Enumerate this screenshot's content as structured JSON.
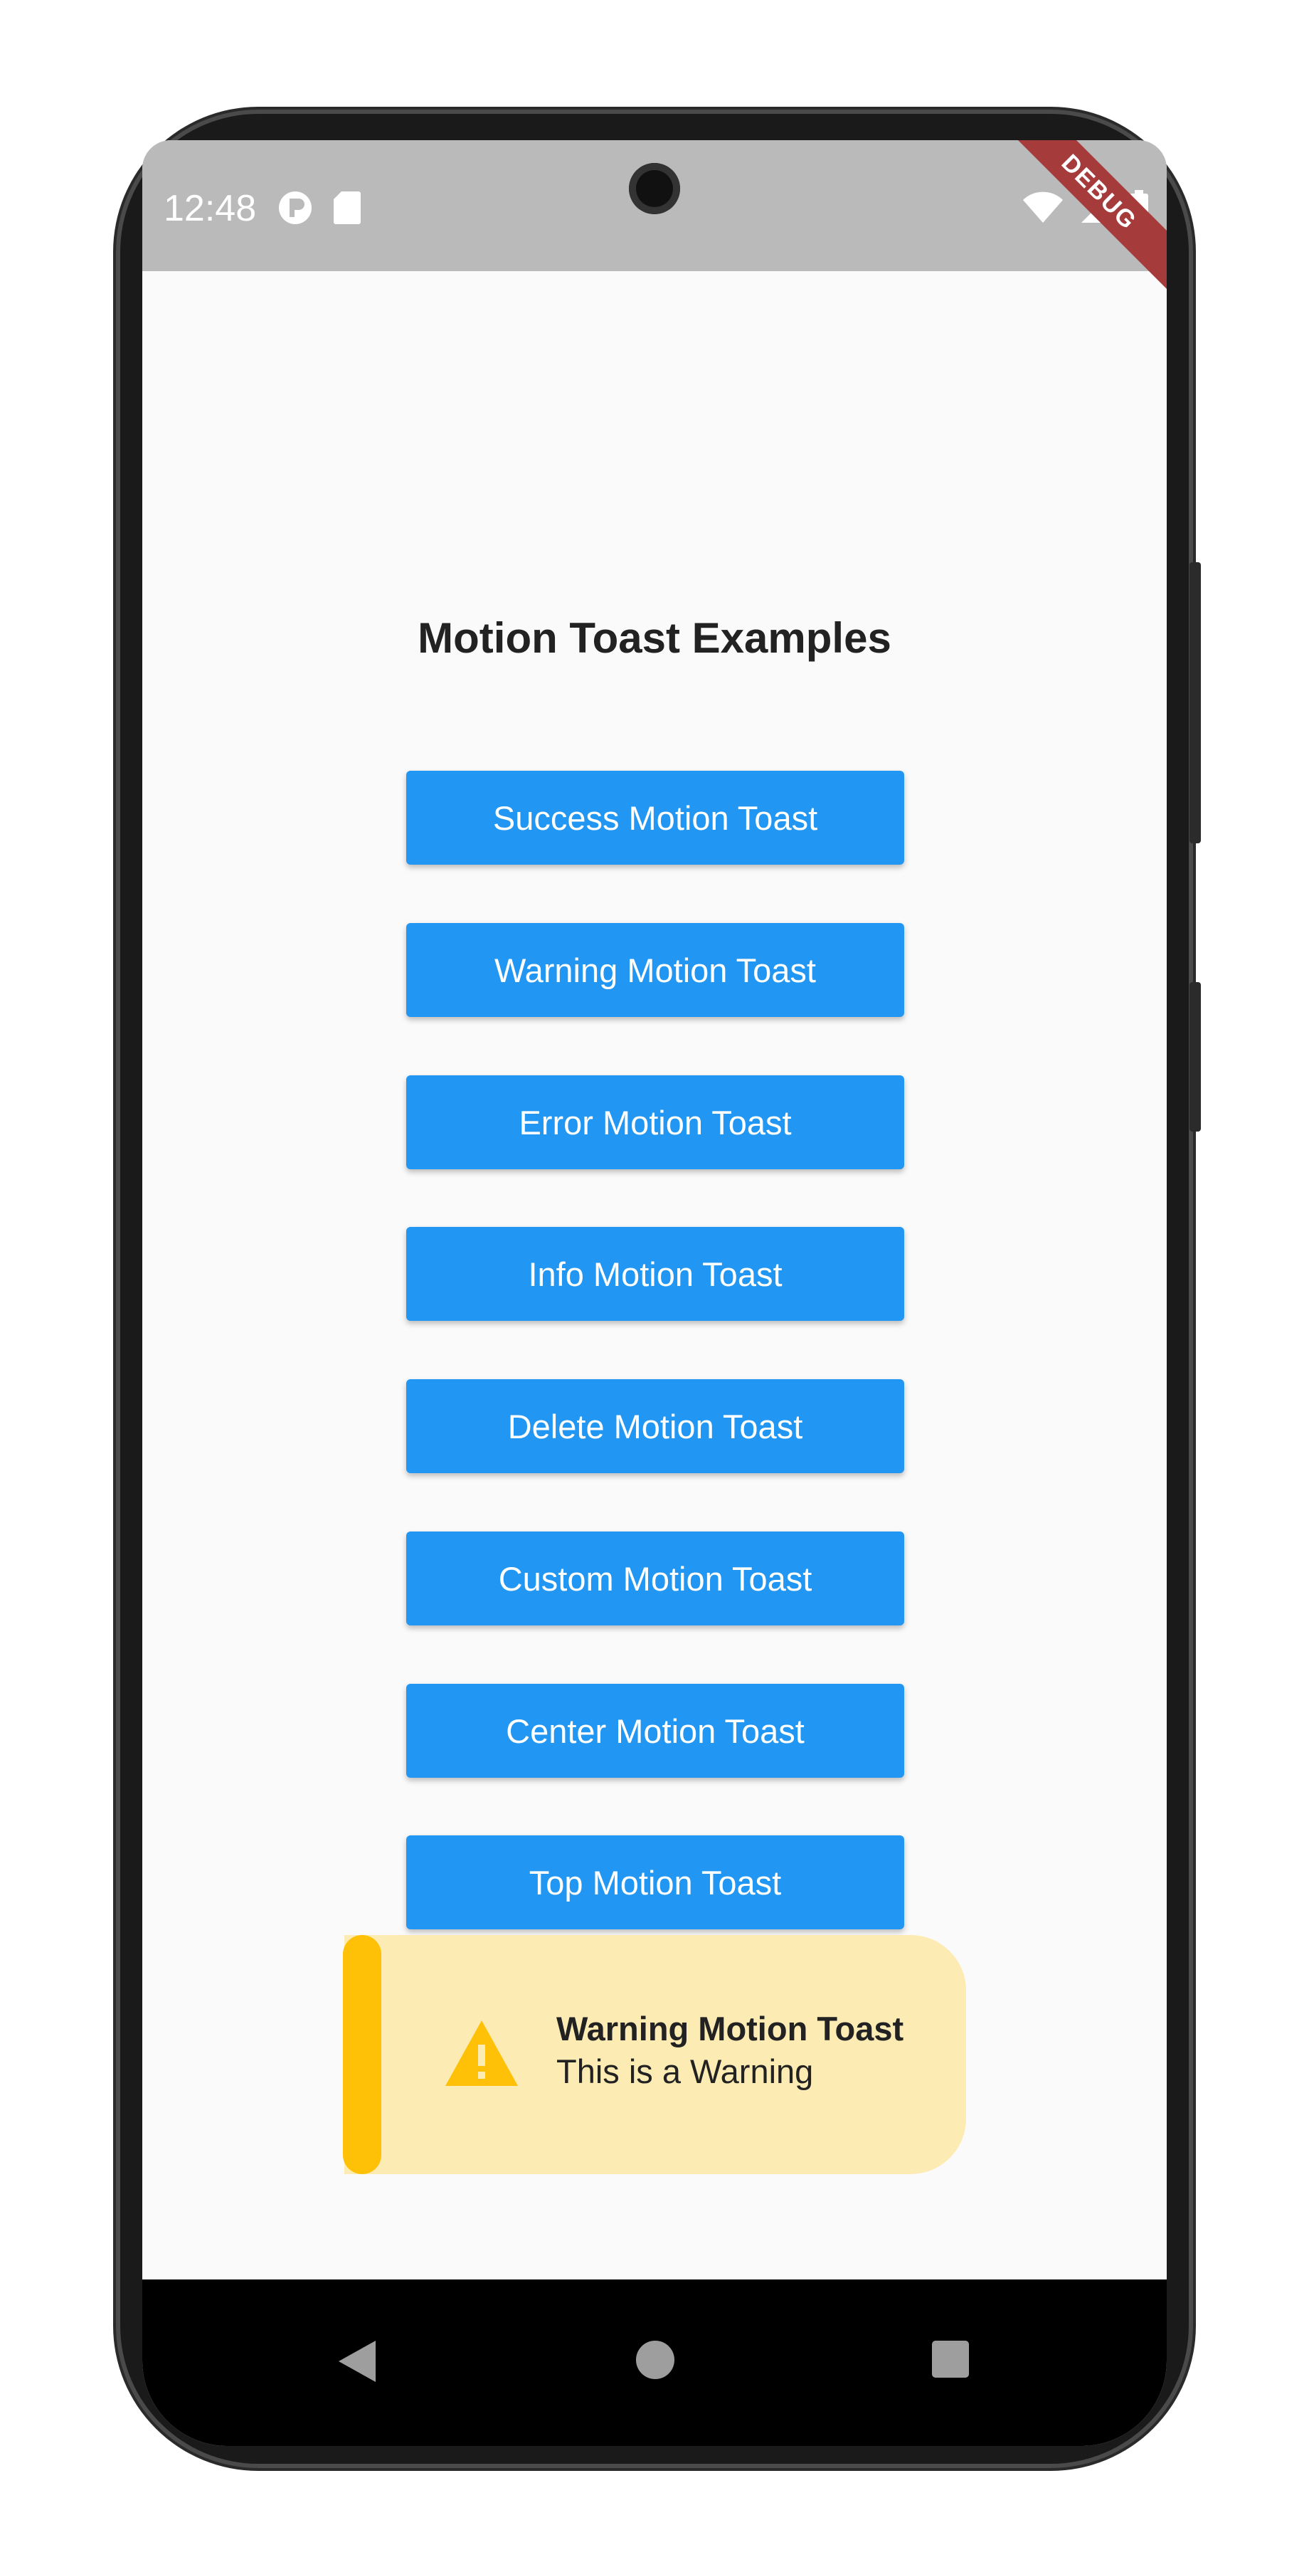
{
  "status_bar": {
    "time": "12:48",
    "left_icons": [
      "app-notification-icon",
      "sd-card-icon"
    ],
    "right_icons": [
      "wifi-icon",
      "cell-signal-icon",
      "battery-icon"
    ]
  },
  "debug_banner": {
    "label": "DEBUG"
  },
  "page": {
    "title": "Motion Toast Examples",
    "buttons": [
      {
        "label": "Success Motion Toast"
      },
      {
        "label": "Warning Motion Toast"
      },
      {
        "label": "Error Motion Toast"
      },
      {
        "label": "Info Motion Toast"
      },
      {
        "label": "Delete Motion Toast"
      },
      {
        "label": "Custom Motion Toast"
      },
      {
        "label": "Center Motion Toast"
      },
      {
        "label": "Top Motion Toast"
      }
    ]
  },
  "toast": {
    "title": "Warning Motion Toast",
    "message": "This is a Warning",
    "icon": "warning-icon",
    "accent_color": "#ffc107",
    "background_color": "#fdebb4"
  },
  "nav_bar": {
    "buttons": [
      "back-icon",
      "home-icon",
      "recents-icon"
    ]
  },
  "colors": {
    "primary": "#2196f3",
    "status_bar": "#bababa",
    "background": "#fafafa"
  }
}
